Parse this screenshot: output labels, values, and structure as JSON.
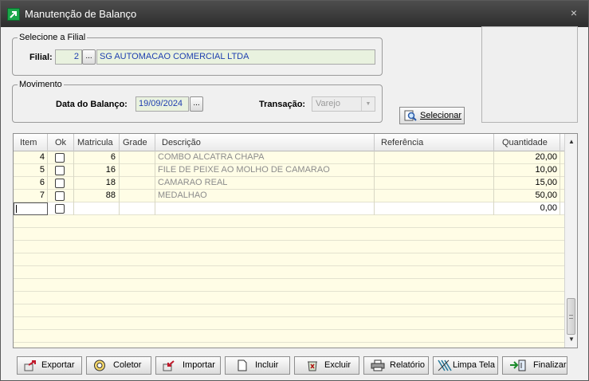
{
  "window": {
    "title": "Manutenção de Balanço",
    "close_glyph": "×"
  },
  "filial_group": {
    "legend": "Selecione a Filial",
    "label": "Filial:",
    "code": "2",
    "lookup_label": "...",
    "name": "SG AUTOMACAO COMERCIAL LTDA"
  },
  "movimento_group": {
    "legend": "Movimento",
    "date_label": "Data do Balanço:",
    "date_value": "19/09/2024",
    "date_btn_label": "...",
    "transacao_label": "Transação:",
    "transacao_value": "Varejo"
  },
  "selecionar_button": {
    "label": "Selecionar",
    "icon": "search-icon"
  },
  "grid": {
    "columns": [
      "Item",
      "Ok",
      "Matricula",
      "Grade",
      "Descrição",
      "Referência",
      "Quantidade"
    ],
    "rows": [
      {
        "item": "4",
        "ok": false,
        "matricula": "6",
        "grade": "",
        "descricao": "COMBO ALCATRA CHAPA",
        "referencia": "",
        "quantidade": "20,00"
      },
      {
        "item": "5",
        "ok": false,
        "matricula": "16",
        "grade": "",
        "descricao": "FILE DE PEIXE AO MOLHO DE CAMARAO",
        "referencia": "",
        "quantidade": "10,00"
      },
      {
        "item": "6",
        "ok": false,
        "matricula": "18",
        "grade": "",
        "descricao": "CAMARAO REAL",
        "referencia": "",
        "quantidade": "15,00"
      },
      {
        "item": "7",
        "ok": false,
        "matricula": "88",
        "grade": "",
        "descricao": "MEDALHAO",
        "referencia": "",
        "quantidade": "50,00"
      }
    ],
    "new_row": {
      "quantidade": "0,00"
    }
  },
  "toolbar": [
    {
      "key": "exportar",
      "label": "Exportar",
      "icon": "export-icon"
    },
    {
      "key": "coletor",
      "label": "Coletor",
      "icon": "collector-icon"
    },
    {
      "key": "importar",
      "label": "Importar",
      "icon": "import-icon"
    },
    {
      "key": "incluir",
      "label": "Incluir",
      "icon": "new-document-icon"
    },
    {
      "key": "excluir",
      "label": "Excluir",
      "icon": "delete-icon"
    },
    {
      "key": "relatorio",
      "label": "Relatório",
      "icon": "printer-icon"
    },
    {
      "key": "limpa_tela",
      "label": "Limpa Tela",
      "icon": "clear-screen-icon"
    },
    {
      "key": "finalizar",
      "label": "Finalizar",
      "icon": "finish-icon"
    }
  ]
}
